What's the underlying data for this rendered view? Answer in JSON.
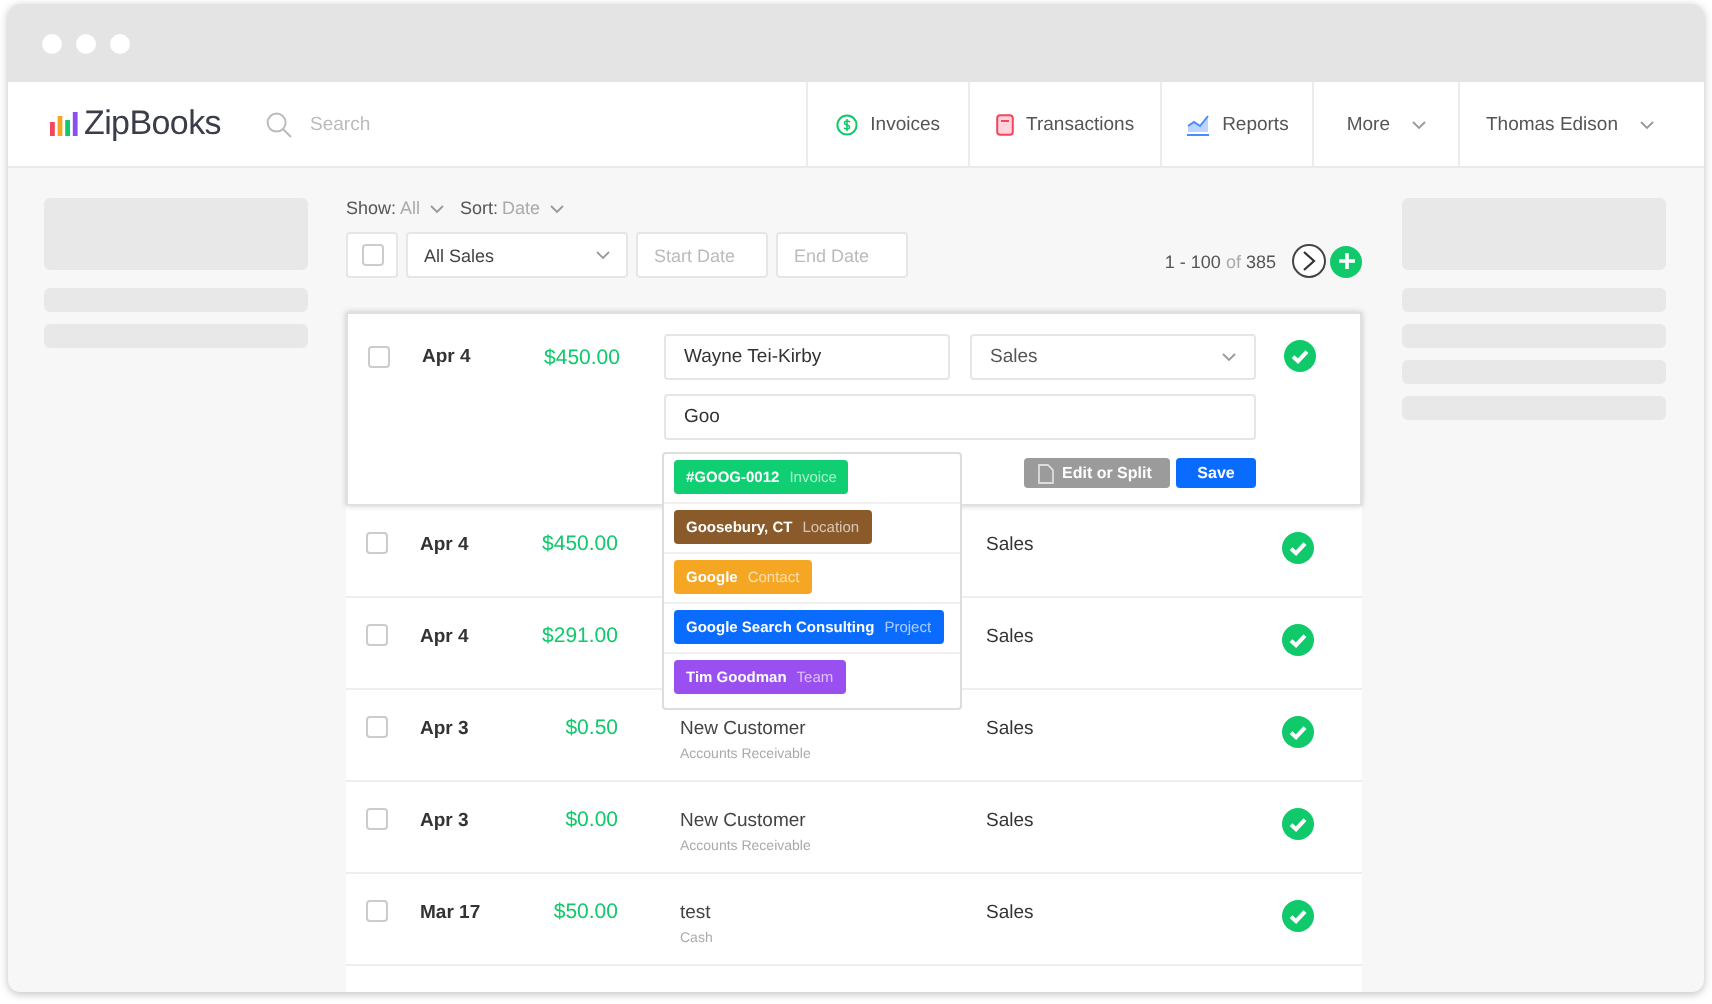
{
  "app": {
    "logo": "ZipBooks",
    "search": {
      "placeholder": "Search"
    }
  },
  "nav": [
    {
      "label": "Invoices",
      "kind": "invoice"
    },
    {
      "label": "Transactions",
      "kind": "transaction"
    },
    {
      "label": "Reports",
      "kind": "report"
    },
    {
      "label": "More",
      "kind": "dropdown"
    },
    {
      "label": "Thomas Edison",
      "kind": "dropdown"
    }
  ],
  "filters": {
    "show": {
      "label": "Show:",
      "value": "All"
    },
    "sort": {
      "label": "Sort:",
      "value": "Date"
    },
    "select_all": {
      "checked": false
    },
    "type_select": "All Sales",
    "start_date": {
      "placeholder": "Start Date"
    },
    "end_date": {
      "placeholder": "End Date"
    }
  },
  "pagination": {
    "range": "1 - 100",
    "of": "of",
    "total": "385"
  },
  "editing_row": {
    "checked": false,
    "date": "Apr 4",
    "amount": "$450.00",
    "payee": "Wayne Tei-Kirby",
    "category": "Sales",
    "memo": "Goo",
    "reconciled": true,
    "buttons": [
      "Edit or Split",
      "Save"
    ]
  },
  "suggestions": [
    {
      "name": "#GOOG-0012",
      "type": "Invoice",
      "color": "#0fcf72"
    },
    {
      "name": "Goosebury, CT",
      "type": "Location",
      "color": "#8a5a2b"
    },
    {
      "name": "Google",
      "type": "Contact",
      "color": "#f5a623"
    },
    {
      "name": "Google Search Consulting",
      "type": "Project",
      "color": "#0a6cff"
    },
    {
      "name": "Tim Goodman",
      "type": "Team",
      "color": "#9a4ff0"
    }
  ],
  "rows": [
    {
      "checked": false,
      "date": "Apr 4",
      "amount": "$450.00",
      "category": "Sales",
      "reconciled": true
    },
    {
      "checked": false,
      "date": "Apr 4",
      "amount": "$291.00",
      "category": "Sales",
      "reconciled": true
    },
    {
      "checked": false,
      "date": "Apr 3",
      "amount": "$0.50",
      "description": "New Customer",
      "account": "Accounts Receivable",
      "category": "Sales",
      "reconciled": true
    },
    {
      "checked": false,
      "date": "Apr 3",
      "amount": "$0.00",
      "description": "New Customer",
      "account": "Accounts Receivable",
      "category": "Sales",
      "reconciled": true
    },
    {
      "checked": false,
      "date": "Mar 17",
      "amount": "$50.00",
      "description": "test",
      "account": "Cash",
      "category": "Sales",
      "reconciled": true
    }
  ]
}
